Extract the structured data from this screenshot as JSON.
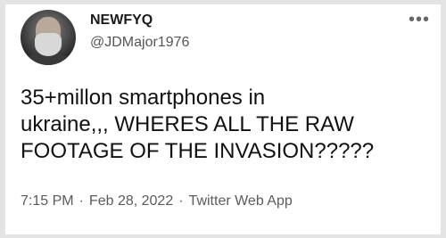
{
  "tweet": {
    "author": {
      "display_name": "NEWFYQ",
      "handle": "@JDMajor1976"
    },
    "more_icon": "more-horizontal-icon",
    "text_lines": [
      "35+millon smartphones in",
      "ukraine,,, WHERES ALL THE RAW",
      "FOOTAGE OF THE INVASION?????"
    ],
    "time": "7:15 PM",
    "date": "Feb 28, 2022",
    "source": "Twitter Web App",
    "separator": "·"
  }
}
